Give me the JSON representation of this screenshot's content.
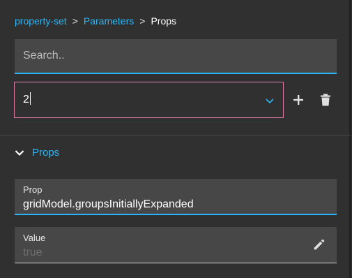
{
  "breadcrumb": {
    "items": [
      "property-set",
      "Parameters",
      "Props"
    ],
    "separator": ">"
  },
  "search": {
    "placeholder": "Search..",
    "value": ""
  },
  "selector": {
    "value": "2"
  },
  "section": {
    "title": "Props",
    "expanded": true
  },
  "prop_field": {
    "label": "Prop",
    "value": "gridModel.groupsInitiallyExpanded"
  },
  "value_field": {
    "label": "Value",
    "placeholder": "true"
  },
  "colors": {
    "accent": "#29b6f6",
    "focus_border": "#e07ba8",
    "field_background": "#474747",
    "panel_background": "#303030"
  },
  "icons": [
    "chevron-down-icon",
    "plus-icon",
    "trash-icon",
    "chevron-down-icon",
    "pencil-icon"
  ]
}
